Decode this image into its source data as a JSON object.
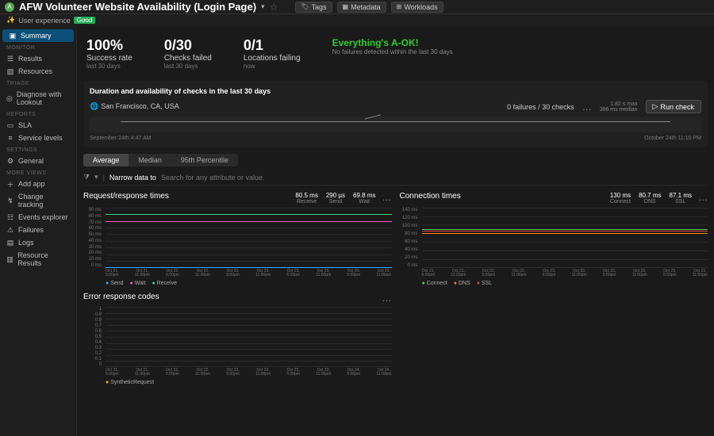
{
  "header": {
    "entity_initial": "A",
    "title": "AFW Volunteer Website Availability (Login Page)",
    "pills": {
      "tags": "Tags",
      "metadata": "Metadata",
      "workloads": "Workloads"
    },
    "ux_label": "User experience",
    "ux_status": "Good"
  },
  "sidebar": {
    "summary": "Summary",
    "sections": {
      "monitor": "MONITOR",
      "triage": "TRIAGE",
      "reports": "REPORTS",
      "settings": "SETTINGS",
      "more": "MORE VIEWS"
    },
    "items": {
      "results": "Results",
      "resources": "Resources",
      "diagnose": "Diagnose with Lookout",
      "sla": "SLA",
      "service_levels": "Service levels",
      "general": "General",
      "add_app": "Add app",
      "change_tracking": "Change tracking",
      "events_explorer": "Events explorer",
      "failures": "Failures",
      "logs": "Logs",
      "resource_results": "Resource Results"
    }
  },
  "kpi": {
    "success_val": "100%",
    "success_label": "Success rate",
    "success_sub": "last 30 days",
    "failed_val": "0/30",
    "failed_label": "Checks failed",
    "failed_sub": "last 30 days",
    "loc_val": "0/1",
    "loc_label": "Locations failing",
    "loc_sub": "now",
    "aok_title": "Everything's A-OK!",
    "aok_sub": "No failures detected within the last 30 days"
  },
  "duration": {
    "heading": "Duration and availability of checks in the last 30 days",
    "location": "San Francisco, CA, USA",
    "failures": "0 failures / 30 checks",
    "max": "1.82 s max",
    "median": "386 ms median",
    "run_check": "Run check",
    "start_date": "September 24th 4:47 AM",
    "end_date": "October 24th 11:15 PM"
  },
  "tabs": {
    "avg": "Average",
    "median": "Median",
    "p95": "95th Percentile"
  },
  "filter": {
    "narrow": "Narrow data to",
    "placeholder": "Search for any attribute or value."
  },
  "rr": {
    "title": "Request/response times",
    "receive_val": "80.5 ms",
    "receive_lbl": "Receive",
    "send_val": "290 µs",
    "send_lbl": "Send",
    "wait_val": "69.8 ms",
    "wait_lbl": "Wait",
    "legend_send": "Send",
    "legend_wait": "Wait",
    "legend_receive": "Receive"
  },
  "conn": {
    "title": "Connection times",
    "connect_val": "130 ms",
    "connect_lbl": "Connect",
    "dns_val": "80.7 ms",
    "dns_lbl": "DNS",
    "ssl_val": "87.1 ms",
    "ssl_lbl": "SSL",
    "legend_connect": "Connect",
    "legend_dns": "DNS",
    "legend_ssl": "SSL"
  },
  "err": {
    "title": "Error response codes",
    "legend": "SyntheticRequest"
  },
  "chart_data": [
    {
      "type": "line",
      "title": "Duration sparkline",
      "x_range": [
        "September 24th 4:47 AM",
        "October 24th 11:15 PM"
      ],
      "series": [
        {
          "name": "duration_ms",
          "values_approx": "flat ~386ms with single spike ~1820ms mid-range"
        }
      ],
      "stats": {
        "max_s": 1.82,
        "median_ms": 386
      },
      "failures": 0,
      "checks": 30
    },
    {
      "type": "line",
      "title": "Request/response times",
      "ylabel": "ms",
      "ylim": [
        0,
        90
      ],
      "yticks": [
        0,
        10,
        20,
        30,
        40,
        50,
        60,
        70,
        80,
        90
      ],
      "categories": [
        "Oct 21, 5:00pm",
        "Oct 21, 11:00pm",
        "Oct 22, 5:00pm",
        "Oct 22, 11:00pm",
        "Oct 23, 5:00pm",
        "Oct 23, 11:00pm",
        "Oct 23, 5:00pm",
        "Oct 23, 11:00pm",
        "Oct 23, 5:00pm",
        "Oct 23, 11:00pm"
      ],
      "series": [
        {
          "name": "Receive",
          "color": "#4c8",
          "value_ms": 80.5,
          "values_approx": "flat ~80"
        },
        {
          "name": "Wait",
          "color": "#f5b",
          "value_ms": 69.8,
          "values_approx": "flat ~70"
        },
        {
          "name": "Send",
          "color": "#3af",
          "value_us": 290,
          "values_approx": "flat ~0"
        }
      ]
    },
    {
      "type": "line",
      "title": "Connection times",
      "ylabel": "ms",
      "ylim": [
        0,
        140
      ],
      "yticks": [
        0,
        20,
        40,
        60,
        80,
        100,
        120,
        140
      ],
      "categories": [
        "Oct 21, 5:00pm",
        "Oct 21, 11:00pm",
        "Oct 22, 5:00pm",
        "Oct 22, 11:00pm",
        "Oct 23, 5:00pm",
        "Oct 23, 11:00pm",
        "Oct 23, 5:00pm",
        "Oct 23, 11:00pm",
        "Oct 23, 5:00pm",
        "Oct 23, 11:00pm"
      ],
      "series": [
        {
          "name": "Connect",
          "color": "#5c5",
          "value_ms": 130,
          "values_approx": "flat ~90 rising to ~95"
        },
        {
          "name": "SSL",
          "color": "#d44",
          "value_ms": 87.1,
          "values_approx": "flat ~87"
        },
        {
          "name": "DNS",
          "color": "#f80",
          "value_ms": 80.7,
          "values_approx": "flat ~80"
        }
      ]
    },
    {
      "type": "line",
      "title": "Error response codes",
      "ylim": [
        0,
        1
      ],
      "yticks": [
        0,
        0.1,
        0.2,
        0.3,
        0.4,
        0.5,
        0.6,
        0.7,
        0.8,
        0.9,
        1
      ],
      "categories": [
        "Oct 21, 5:00pm",
        "Oct 21, 11:00pm",
        "Oct 22, 5:00pm",
        "Oct 22, 11:00pm",
        "Oct 23, 5:00pm",
        "Oct 23, 11:00pm",
        "Oct 23, 5:00pm",
        "Oct 23, 11:00pm",
        "Oct 24, 5:00pm",
        "Oct 24, 11:00pm"
      ],
      "series": [
        {
          "name": "SyntheticRequest",
          "color": "#fa0",
          "values_approx": "all zero"
        }
      ]
    }
  ]
}
